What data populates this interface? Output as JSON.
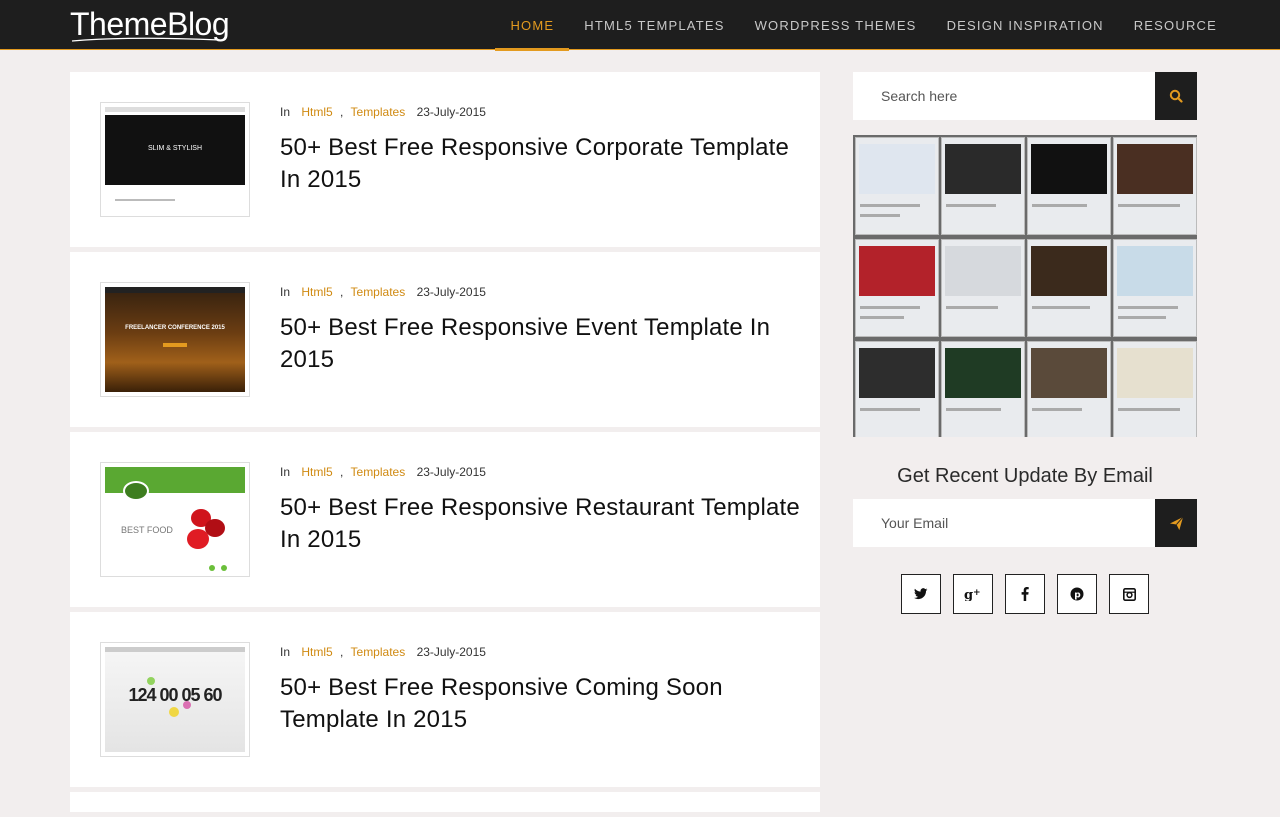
{
  "header": {
    "logo": "ThemeBlog",
    "nav": [
      "Home",
      "HTML5 Templates",
      "Wordpress Themes",
      "Design Inspiration",
      "Resource"
    ]
  },
  "posts": [
    {
      "in_label": "In",
      "cat1": "Html5",
      "comma": ",",
      "cat2": "Templates",
      "date": "23-July-2015",
      "title": "50+ Best Free Responsive Corporate Template In 2015",
      "thumb_text": "SLIM & STYLISH"
    },
    {
      "in_label": "In",
      "cat1": "Html5",
      "comma": ",",
      "cat2": "Templates",
      "date": "23-July-2015",
      "title": "50+ Best Free Responsive Event Template In 2015",
      "thumb_text": "FREELANCER CONFERENCE 2015"
    },
    {
      "in_label": "In",
      "cat1": "Html5",
      "comma": ",",
      "cat2": "Templates",
      "date": "23-July-2015",
      "title": "50+ Best Free Responsive Restaurant Template In 2015",
      "thumb_text": "BEST FOOD"
    },
    {
      "in_label": "In",
      "cat1": "Html5",
      "comma": ",",
      "cat2": "Templates",
      "date": "23-July-2015",
      "title": "50+ Best Free Responsive Coming Soon Template In 2015",
      "thumb_text": "124 00 05 60"
    }
  ],
  "sidebar": {
    "search_placeholder": "Search here",
    "signup_title": "Get Recent Update By Email",
    "email_placeholder": "Your Email",
    "social": [
      "twitter-icon",
      "google-plus-icon",
      "facebook-icon",
      "pinterest-icon",
      "instagram-icon"
    ]
  },
  "colors": {
    "accent": "#e39a1f",
    "dark": "#1e1e1e",
    "background": "#f2eeee"
  }
}
